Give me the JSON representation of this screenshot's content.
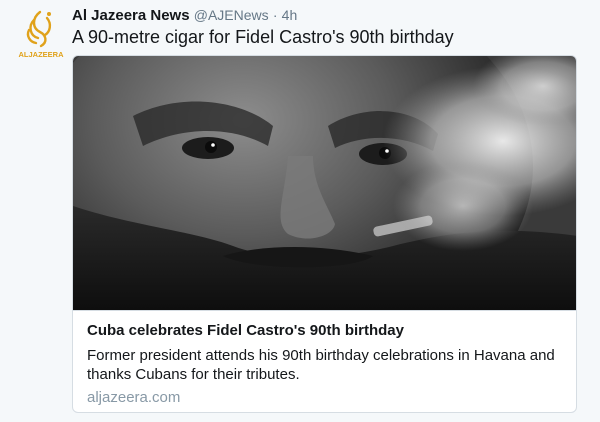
{
  "tweet": {
    "author_name": "Al Jazeera News",
    "handle": "@AJENews",
    "separator": "·",
    "time": "4h",
    "text": "A 90-metre cigar for Fidel Castro's 90th birthday",
    "avatar_logo_text": "ALJAZEERA"
  },
  "card": {
    "title": "Cuba celebrates Fidel Castro's 90th birthday",
    "description": "Former president attends his 90th birthday celebrations in Havana and thanks Cubans for their tributes.",
    "domain": "aljazeera.com"
  },
  "colors": {
    "background": "#f5f8fa",
    "text": "#14171a",
    "muted": "#657786",
    "link": "#8899a6",
    "logo_gold": "#e0a21b"
  }
}
